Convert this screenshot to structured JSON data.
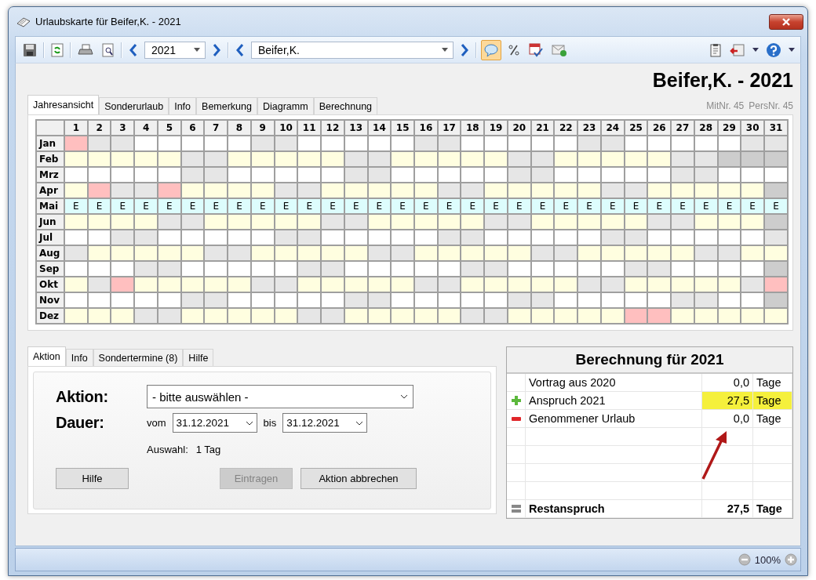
{
  "window": {
    "title": "Urlaubskarte für Beifer,K. - 2021"
  },
  "toolbar": {
    "year": "2021",
    "person": "Beifer,K.",
    "comment_pressed": true
  },
  "heading": "Beifer,K. - 2021",
  "ids": [
    "MitNr. 45",
    "PersNr. 45"
  ],
  "top_tabs": [
    {
      "label": "Jahresansicht",
      "selected": true
    },
    {
      "label": "Sonderurlaub",
      "selected": false
    },
    {
      "label": "Info",
      "selected": false
    },
    {
      "label": "Bemerkung",
      "selected": false
    },
    {
      "label": "Diagramm",
      "selected": false
    },
    {
      "label": "Berechnung",
      "selected": false
    }
  ],
  "calendar": {
    "days": [
      "1",
      "2",
      "3",
      "4",
      "5",
      "6",
      "7",
      "8",
      "9",
      "10",
      "11",
      "12",
      "13",
      "14",
      "15",
      "16",
      "17",
      "18",
      "19",
      "20",
      "21",
      "22",
      "23",
      "24",
      "25",
      "26",
      "27",
      "28",
      "29",
      "30",
      "31"
    ],
    "months": [
      {
        "name": "Jan",
        "cells": [
          {
            "kind": "holiday"
          },
          {
            "kind": "weekend"
          },
          {
            "kind": "weekend"
          },
          {
            "kind": "work"
          },
          {
            "kind": "work"
          },
          {
            "kind": "work"
          },
          {
            "kind": "work"
          },
          {
            "kind": "work"
          },
          {
            "kind": "weekend"
          },
          {
            "kind": "weekend"
          },
          {
            "kind": "work"
          },
          {
            "kind": "work"
          },
          {
            "kind": "work"
          },
          {
            "kind": "work"
          },
          {
            "kind": "work"
          },
          {
            "kind": "weekend"
          },
          {
            "kind": "weekend"
          },
          {
            "kind": "work"
          },
          {
            "kind": "work"
          },
          {
            "kind": "work"
          },
          {
            "kind": "work"
          },
          {
            "kind": "work"
          },
          {
            "kind": "weekend"
          },
          {
            "kind": "weekend"
          },
          {
            "kind": "work"
          },
          {
            "kind": "work"
          },
          {
            "kind": "work"
          },
          {
            "kind": "work"
          },
          {
            "kind": "work"
          },
          {
            "kind": "weekend"
          },
          {
            "kind": "weekend"
          }
        ]
      },
      {
        "name": "Feb",
        "cells": [
          {
            "kind": "work"
          },
          {
            "kind": "work"
          },
          {
            "kind": "work"
          },
          {
            "kind": "work"
          },
          {
            "kind": "work"
          },
          {
            "kind": "weekend"
          },
          {
            "kind": "weekend"
          },
          {
            "kind": "work"
          },
          {
            "kind": "work"
          },
          {
            "kind": "work"
          },
          {
            "kind": "work"
          },
          {
            "kind": "work"
          },
          {
            "kind": "weekend"
          },
          {
            "kind": "weekend"
          },
          {
            "kind": "work"
          },
          {
            "kind": "work"
          },
          {
            "kind": "work"
          },
          {
            "kind": "work"
          },
          {
            "kind": "work"
          },
          {
            "kind": "weekend"
          },
          {
            "kind": "weekend"
          },
          {
            "kind": "work"
          },
          {
            "kind": "work"
          },
          {
            "kind": "work"
          },
          {
            "kind": "work"
          },
          {
            "kind": "work"
          },
          {
            "kind": "weekend"
          },
          {
            "kind": "weekend"
          },
          {
            "kind": "none"
          },
          {
            "kind": "none"
          },
          {
            "kind": "none"
          }
        ]
      },
      {
        "name": "Mrz",
        "cells": [
          {
            "kind": "work"
          },
          {
            "kind": "work"
          },
          {
            "kind": "work"
          },
          {
            "kind": "work"
          },
          {
            "kind": "work"
          },
          {
            "kind": "weekend"
          },
          {
            "kind": "weekend"
          },
          {
            "kind": "work"
          },
          {
            "kind": "work"
          },
          {
            "kind": "work"
          },
          {
            "kind": "work"
          },
          {
            "kind": "work"
          },
          {
            "kind": "weekend"
          },
          {
            "kind": "weekend"
          },
          {
            "kind": "work"
          },
          {
            "kind": "work"
          },
          {
            "kind": "work"
          },
          {
            "kind": "work"
          },
          {
            "kind": "work"
          },
          {
            "kind": "weekend"
          },
          {
            "kind": "weekend"
          },
          {
            "kind": "work"
          },
          {
            "kind": "work"
          },
          {
            "kind": "work"
          },
          {
            "kind": "work"
          },
          {
            "kind": "work"
          },
          {
            "kind": "weekend"
          },
          {
            "kind": "weekend"
          },
          {
            "kind": "work"
          },
          {
            "kind": "work"
          },
          {
            "kind": "work"
          }
        ]
      },
      {
        "name": "Apr",
        "cells": [
          {
            "kind": "work"
          },
          {
            "kind": "holiday"
          },
          {
            "kind": "weekend"
          },
          {
            "kind": "weekend"
          },
          {
            "kind": "holiday"
          },
          {
            "kind": "work"
          },
          {
            "kind": "work"
          },
          {
            "kind": "work"
          },
          {
            "kind": "work"
          },
          {
            "kind": "weekend"
          },
          {
            "kind": "weekend"
          },
          {
            "kind": "work"
          },
          {
            "kind": "work"
          },
          {
            "kind": "work"
          },
          {
            "kind": "work"
          },
          {
            "kind": "work"
          },
          {
            "kind": "weekend"
          },
          {
            "kind": "weekend"
          },
          {
            "kind": "work"
          },
          {
            "kind": "work"
          },
          {
            "kind": "work"
          },
          {
            "kind": "work"
          },
          {
            "kind": "work"
          },
          {
            "kind": "weekend"
          },
          {
            "kind": "weekend"
          },
          {
            "kind": "work"
          },
          {
            "kind": "work"
          },
          {
            "kind": "work"
          },
          {
            "kind": "work"
          },
          {
            "kind": "work"
          },
          {
            "kind": "none"
          }
        ]
      },
      {
        "name": "Mai",
        "cells": [
          {
            "kind": "entry",
            "text": "E"
          },
          {
            "kind": "entry",
            "text": "E"
          },
          {
            "kind": "entry",
            "text": "E"
          },
          {
            "kind": "entry",
            "text": "E"
          },
          {
            "kind": "entry",
            "text": "E"
          },
          {
            "kind": "entry",
            "text": "E"
          },
          {
            "kind": "entry",
            "text": "E"
          },
          {
            "kind": "entry",
            "text": "E"
          },
          {
            "kind": "entry",
            "text": "E"
          },
          {
            "kind": "entry",
            "text": "E"
          },
          {
            "kind": "entry",
            "text": "E"
          },
          {
            "kind": "entry",
            "text": "E"
          },
          {
            "kind": "entry",
            "text": "E"
          },
          {
            "kind": "entry",
            "text": "E"
          },
          {
            "kind": "entry",
            "text": "E"
          },
          {
            "kind": "entry",
            "text": "E"
          },
          {
            "kind": "entry",
            "text": "E"
          },
          {
            "kind": "entry",
            "text": "E"
          },
          {
            "kind": "entry",
            "text": "E"
          },
          {
            "kind": "entry",
            "text": "E"
          },
          {
            "kind": "entry",
            "text": "E"
          },
          {
            "kind": "entry",
            "text": "E"
          },
          {
            "kind": "entry",
            "text": "E"
          },
          {
            "kind": "entry",
            "text": "E"
          },
          {
            "kind": "entry",
            "text": "E"
          },
          {
            "kind": "entry",
            "text": "E"
          },
          {
            "kind": "entry",
            "text": "E"
          },
          {
            "kind": "entry",
            "text": "E"
          },
          {
            "kind": "entry",
            "text": "E"
          },
          {
            "kind": "entry",
            "text": "E"
          },
          {
            "kind": "entry",
            "text": "E"
          }
        ]
      },
      {
        "name": "Jun",
        "cells": [
          {
            "kind": "work"
          },
          {
            "kind": "work"
          },
          {
            "kind": "work"
          },
          {
            "kind": "work"
          },
          {
            "kind": "weekend"
          },
          {
            "kind": "weekend"
          },
          {
            "kind": "work"
          },
          {
            "kind": "work"
          },
          {
            "kind": "work"
          },
          {
            "kind": "work"
          },
          {
            "kind": "work"
          },
          {
            "kind": "weekend"
          },
          {
            "kind": "weekend"
          },
          {
            "kind": "work"
          },
          {
            "kind": "work"
          },
          {
            "kind": "work"
          },
          {
            "kind": "work"
          },
          {
            "kind": "work"
          },
          {
            "kind": "weekend"
          },
          {
            "kind": "weekend"
          },
          {
            "kind": "work"
          },
          {
            "kind": "work"
          },
          {
            "kind": "work"
          },
          {
            "kind": "work"
          },
          {
            "kind": "work"
          },
          {
            "kind": "weekend"
          },
          {
            "kind": "weekend"
          },
          {
            "kind": "work"
          },
          {
            "kind": "work"
          },
          {
            "kind": "work"
          },
          {
            "kind": "none"
          }
        ]
      },
      {
        "name": "Jul",
        "cells": [
          {
            "kind": "work"
          },
          {
            "kind": "work"
          },
          {
            "kind": "weekend"
          },
          {
            "kind": "weekend"
          },
          {
            "kind": "work"
          },
          {
            "kind": "work"
          },
          {
            "kind": "work"
          },
          {
            "kind": "work"
          },
          {
            "kind": "work"
          },
          {
            "kind": "weekend"
          },
          {
            "kind": "weekend"
          },
          {
            "kind": "work"
          },
          {
            "kind": "work"
          },
          {
            "kind": "work"
          },
          {
            "kind": "work"
          },
          {
            "kind": "work"
          },
          {
            "kind": "weekend"
          },
          {
            "kind": "weekend"
          },
          {
            "kind": "work"
          },
          {
            "kind": "work"
          },
          {
            "kind": "work"
          },
          {
            "kind": "work"
          },
          {
            "kind": "work"
          },
          {
            "kind": "weekend"
          },
          {
            "kind": "weekend"
          },
          {
            "kind": "work"
          },
          {
            "kind": "work"
          },
          {
            "kind": "work"
          },
          {
            "kind": "work"
          },
          {
            "kind": "work"
          },
          {
            "kind": "weekend"
          }
        ]
      },
      {
        "name": "Aug",
        "cells": [
          {
            "kind": "weekend"
          },
          {
            "kind": "work"
          },
          {
            "kind": "work"
          },
          {
            "kind": "work"
          },
          {
            "kind": "work"
          },
          {
            "kind": "work"
          },
          {
            "kind": "weekend"
          },
          {
            "kind": "weekend"
          },
          {
            "kind": "work"
          },
          {
            "kind": "work"
          },
          {
            "kind": "work"
          },
          {
            "kind": "work"
          },
          {
            "kind": "work"
          },
          {
            "kind": "weekend"
          },
          {
            "kind": "weekend"
          },
          {
            "kind": "work"
          },
          {
            "kind": "work"
          },
          {
            "kind": "work"
          },
          {
            "kind": "work"
          },
          {
            "kind": "work"
          },
          {
            "kind": "weekend"
          },
          {
            "kind": "weekend"
          },
          {
            "kind": "work"
          },
          {
            "kind": "work"
          },
          {
            "kind": "work"
          },
          {
            "kind": "work"
          },
          {
            "kind": "work"
          },
          {
            "kind": "weekend"
          },
          {
            "kind": "weekend"
          },
          {
            "kind": "work"
          },
          {
            "kind": "work"
          }
        ]
      },
      {
        "name": "Sep",
        "cells": [
          {
            "kind": "work"
          },
          {
            "kind": "work"
          },
          {
            "kind": "work"
          },
          {
            "kind": "weekend"
          },
          {
            "kind": "weekend"
          },
          {
            "kind": "work"
          },
          {
            "kind": "work"
          },
          {
            "kind": "work"
          },
          {
            "kind": "work"
          },
          {
            "kind": "work"
          },
          {
            "kind": "weekend"
          },
          {
            "kind": "weekend"
          },
          {
            "kind": "work"
          },
          {
            "kind": "work"
          },
          {
            "kind": "work"
          },
          {
            "kind": "work"
          },
          {
            "kind": "work"
          },
          {
            "kind": "weekend"
          },
          {
            "kind": "weekend"
          },
          {
            "kind": "work"
          },
          {
            "kind": "work"
          },
          {
            "kind": "work"
          },
          {
            "kind": "work"
          },
          {
            "kind": "work"
          },
          {
            "kind": "weekend"
          },
          {
            "kind": "weekend"
          },
          {
            "kind": "work"
          },
          {
            "kind": "work"
          },
          {
            "kind": "work"
          },
          {
            "kind": "work"
          },
          {
            "kind": "none"
          }
        ]
      },
      {
        "name": "Okt",
        "cells": [
          {
            "kind": "work"
          },
          {
            "kind": "weekend"
          },
          {
            "kind": "holiday"
          },
          {
            "kind": "work"
          },
          {
            "kind": "work"
          },
          {
            "kind": "work"
          },
          {
            "kind": "work"
          },
          {
            "kind": "work"
          },
          {
            "kind": "weekend"
          },
          {
            "kind": "weekend"
          },
          {
            "kind": "work"
          },
          {
            "kind": "work"
          },
          {
            "kind": "work"
          },
          {
            "kind": "work"
          },
          {
            "kind": "work"
          },
          {
            "kind": "weekend"
          },
          {
            "kind": "weekend"
          },
          {
            "kind": "work"
          },
          {
            "kind": "work"
          },
          {
            "kind": "work"
          },
          {
            "kind": "work"
          },
          {
            "kind": "work"
          },
          {
            "kind": "weekend"
          },
          {
            "kind": "weekend"
          },
          {
            "kind": "work"
          },
          {
            "kind": "work"
          },
          {
            "kind": "work"
          },
          {
            "kind": "work"
          },
          {
            "kind": "work"
          },
          {
            "kind": "weekend"
          },
          {
            "kind": "holiday"
          }
        ]
      },
      {
        "name": "Nov",
        "cells": [
          {
            "kind": "work"
          },
          {
            "kind": "work"
          },
          {
            "kind": "work"
          },
          {
            "kind": "work"
          },
          {
            "kind": "work"
          },
          {
            "kind": "weekend"
          },
          {
            "kind": "weekend"
          },
          {
            "kind": "work"
          },
          {
            "kind": "work"
          },
          {
            "kind": "work"
          },
          {
            "kind": "work"
          },
          {
            "kind": "work"
          },
          {
            "kind": "weekend"
          },
          {
            "kind": "weekend"
          },
          {
            "kind": "work"
          },
          {
            "kind": "work"
          },
          {
            "kind": "work"
          },
          {
            "kind": "work"
          },
          {
            "kind": "work"
          },
          {
            "kind": "weekend"
          },
          {
            "kind": "weekend"
          },
          {
            "kind": "work"
          },
          {
            "kind": "work"
          },
          {
            "kind": "work"
          },
          {
            "kind": "work"
          },
          {
            "kind": "work"
          },
          {
            "kind": "weekend"
          },
          {
            "kind": "weekend"
          },
          {
            "kind": "work"
          },
          {
            "kind": "work"
          },
          {
            "kind": "none"
          }
        ]
      },
      {
        "name": "Dez",
        "cells": [
          {
            "kind": "work"
          },
          {
            "kind": "work"
          },
          {
            "kind": "work"
          },
          {
            "kind": "weekend"
          },
          {
            "kind": "weekend"
          },
          {
            "kind": "work"
          },
          {
            "kind": "work"
          },
          {
            "kind": "work"
          },
          {
            "kind": "work"
          },
          {
            "kind": "work"
          },
          {
            "kind": "weekend"
          },
          {
            "kind": "weekend"
          },
          {
            "kind": "work"
          },
          {
            "kind": "work"
          },
          {
            "kind": "work"
          },
          {
            "kind": "work"
          },
          {
            "kind": "work"
          },
          {
            "kind": "weekend"
          },
          {
            "kind": "weekend"
          },
          {
            "kind": "work"
          },
          {
            "kind": "work"
          },
          {
            "kind": "work"
          },
          {
            "kind": "work"
          },
          {
            "kind": "work"
          },
          {
            "kind": "holiday"
          },
          {
            "kind": "holiday"
          },
          {
            "kind": "work"
          },
          {
            "kind": "work"
          },
          {
            "kind": "work"
          },
          {
            "kind": "work"
          },
          {
            "kind": "work"
          }
        ]
      }
    ]
  },
  "bottom_tabs": [
    {
      "label": "Aktion",
      "selected": true
    },
    {
      "label": "Info",
      "selected": false
    },
    {
      "label": "Sondertermine (8)",
      "selected": false
    },
    {
      "label": "Hilfe",
      "selected": false
    }
  ],
  "action": {
    "aktion_label": "Aktion:",
    "aktion_value": "- bitte auswählen -",
    "dauer_label": "Dauer:",
    "from_label": "vom",
    "from_value": "31.12.2021",
    "to_label": "bis",
    "to_value": "31.12.2021",
    "selection_label": "Auswahl:",
    "selection_value": "1 Tag",
    "buttons": [
      {
        "label": "Hilfe",
        "disabled": false
      },
      {
        "label": "Eintragen",
        "disabled": true
      },
      {
        "label": "Aktion abbrechen",
        "disabled": false
      }
    ]
  },
  "calculation": {
    "title": "Berechnung für 2021",
    "rows": [
      {
        "kind": "plain",
        "label": "Vortrag aus 2020",
        "value": "0,0",
        "unit": "Tage",
        "highlighted": false
      },
      {
        "kind": "plus",
        "label": "Anspruch 2021",
        "value": "27,5",
        "unit": "Tage",
        "highlighted": true
      },
      {
        "kind": "minus",
        "label": "Genommener Urlaub",
        "value": "0,0",
        "unit": "Tage",
        "highlighted": false
      },
      {
        "kind": "total",
        "label": "Restanspruch",
        "value": "27,5",
        "unit": "Tage",
        "highlighted": false
      }
    ]
  },
  "status_bar": {
    "zoom": "100%"
  }
}
